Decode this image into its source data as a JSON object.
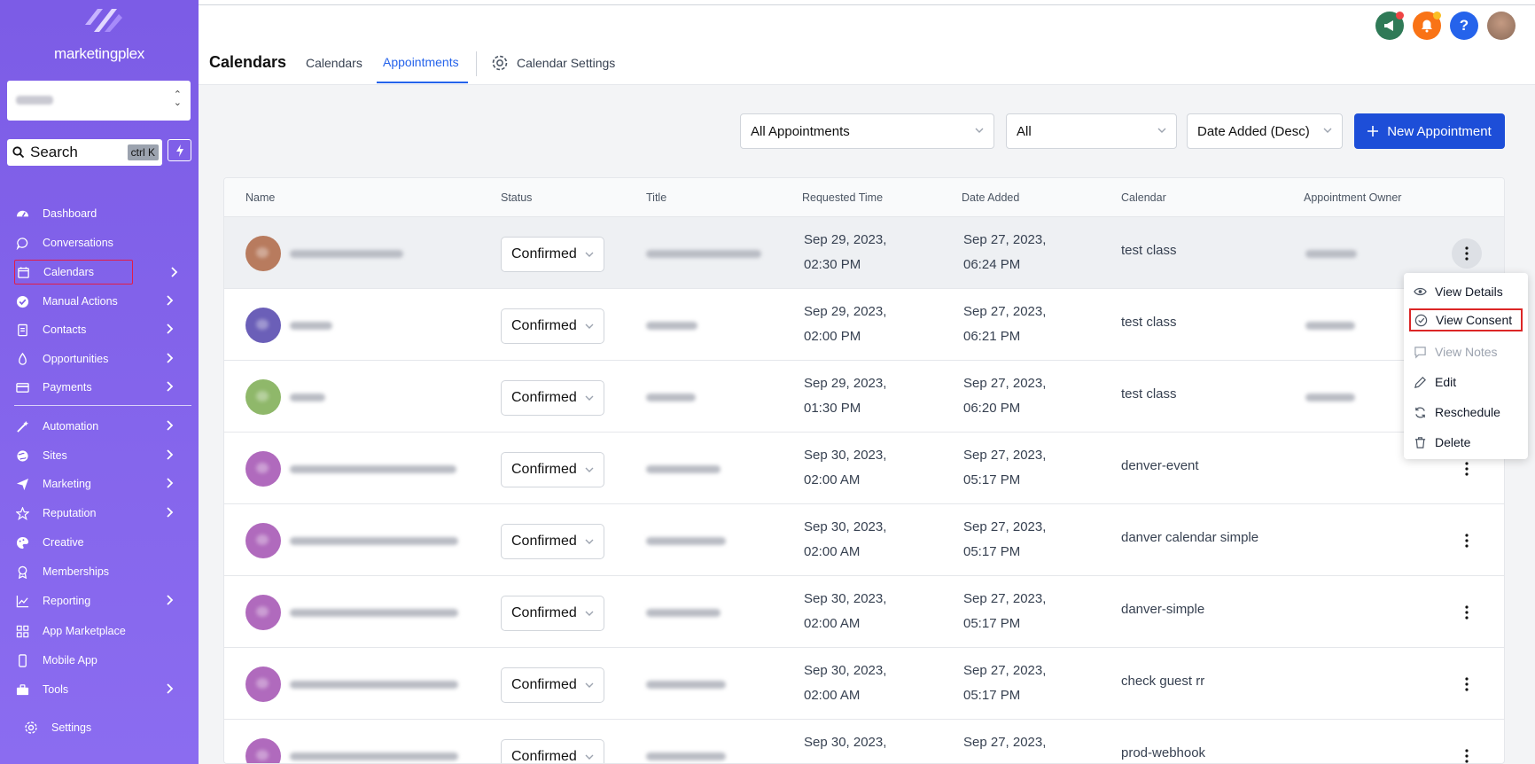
{
  "sidebar": {
    "brand": "marketingplex",
    "search": {
      "placeholder": "Search",
      "shortcut": "ctrl K"
    },
    "items": [
      {
        "label": "Dashboard",
        "icon": "dashboard-icon"
      },
      {
        "label": "Conversations",
        "icon": "chat-icon"
      },
      {
        "label": "Calendars",
        "icon": "calendar-icon",
        "active": true
      },
      {
        "label": "Manual Actions",
        "icon": "check-circle-icon"
      },
      {
        "label": "Contacts",
        "icon": "contacts-icon"
      },
      {
        "label": "Opportunities",
        "icon": "funnel-icon"
      },
      {
        "label": "Payments",
        "icon": "card-icon"
      },
      {
        "label": "Automation",
        "icon": "wand-icon"
      },
      {
        "label": "Sites",
        "icon": "globe-icon"
      },
      {
        "label": "Marketing",
        "icon": "send-icon"
      },
      {
        "label": "Reputation",
        "icon": "star-icon"
      },
      {
        "label": "Creative",
        "icon": "palette-icon"
      },
      {
        "label": "Memberships",
        "icon": "badge-icon"
      },
      {
        "label": "Reporting",
        "icon": "chart-icon"
      },
      {
        "label": "App Marketplace",
        "icon": "grid-icon"
      },
      {
        "label": "Mobile App",
        "icon": "mobile-icon"
      },
      {
        "label": "Tools",
        "icon": "briefcase-icon"
      },
      {
        "label": "Settings",
        "icon": "gear-icon"
      }
    ]
  },
  "header": {
    "title": "Calendars",
    "tabs": [
      "Calendars",
      "Appointments",
      "Calendar Settings"
    ],
    "active_tab": "Appointments",
    "help_label": "?"
  },
  "filters": {
    "type": "All Appointments",
    "status": "All",
    "sort": "Date Added (Desc)",
    "new_button": "New Appointment"
  },
  "table": {
    "columns": [
      "Name",
      "Status",
      "Title",
      "Requested Time",
      "Date Added",
      "Calendar",
      "Appointment Owner"
    ],
    "rows": [
      {
        "status": "Confirmed",
        "req1": "Sep 29, 2023,",
        "req2": "02:30 PM",
        "add1": "Sep 27, 2023,",
        "add2": "06:24 PM",
        "calendar": "test class",
        "avatar_color": "#b87b5e"
      },
      {
        "status": "Confirmed",
        "req1": "Sep 29, 2023,",
        "req2": "02:00 PM",
        "add1": "Sep 27, 2023,",
        "add2": "06:21 PM",
        "calendar": "test class",
        "avatar_color": "#6b5fb8"
      },
      {
        "status": "Confirmed",
        "req1": "Sep 29, 2023,",
        "req2": "01:30 PM",
        "add1": "Sep 27, 2023,",
        "add2": "06:20 PM",
        "calendar": "test class",
        "avatar_color": "#8fb86a"
      },
      {
        "status": "Confirmed",
        "req1": "Sep 30, 2023,",
        "req2": "02:00 AM",
        "add1": "Sep 27, 2023,",
        "add2": "05:17 PM",
        "calendar": "denver-event",
        "avatar_color": "#b06abd"
      },
      {
        "status": "Confirmed",
        "req1": "Sep 30, 2023,",
        "req2": "02:00 AM",
        "add1": "Sep 27, 2023,",
        "add2": "05:17 PM",
        "calendar": "danver calendar simple",
        "avatar_color": "#b06abd"
      },
      {
        "status": "Confirmed",
        "req1": "Sep 30, 2023,",
        "req2": "02:00 AM",
        "add1": "Sep 27, 2023,",
        "add2": "05:17 PM",
        "calendar": "danver-simple",
        "avatar_color": "#b06abd"
      },
      {
        "status": "Confirmed",
        "req1": "Sep 30, 2023,",
        "req2": "02:00 AM",
        "add1": "Sep 27, 2023,",
        "add2": "05:17 PM",
        "calendar": "check guest rr",
        "avatar_color": "#b06abd"
      },
      {
        "status": "Confirmed",
        "req1": "Sep 30, 2023,",
        "req2": "",
        "add1": "Sep 27, 2023,",
        "add2": "",
        "calendar": "prod-webhook",
        "avatar_color": "#b06abd"
      }
    ]
  },
  "context_menu": {
    "items": [
      {
        "label": "View Details",
        "icon": "eye-icon"
      },
      {
        "label": "View Consent",
        "icon": "check-circle-icon",
        "highlighted": true
      },
      {
        "label": "View Notes",
        "icon": "notes-icon",
        "disabled": true
      },
      {
        "label": "Edit",
        "icon": "pencil-icon"
      },
      {
        "label": "Reschedule",
        "icon": "refresh-icon"
      },
      {
        "label": "Delete",
        "icon": "trash-icon"
      }
    ]
  },
  "colors": {
    "sidebar": "#7c5ce6",
    "accent": "#1d4ed8",
    "highlight": "#dc2626"
  }
}
